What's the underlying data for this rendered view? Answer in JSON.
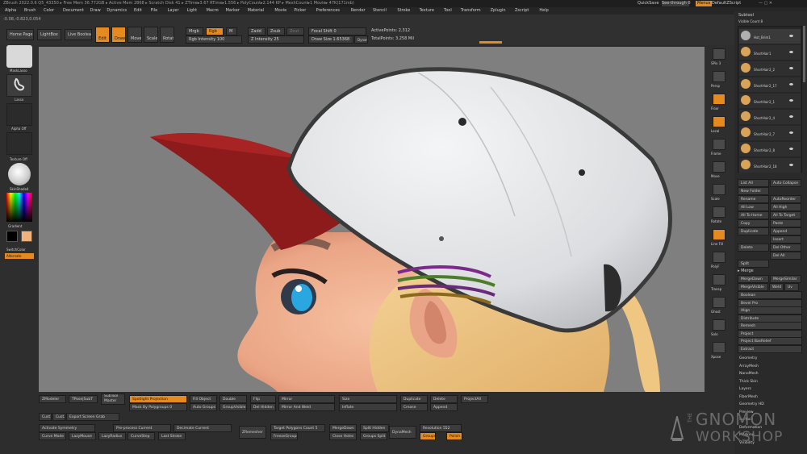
{
  "titlebar": {
    "text": "ZBrush 2022.0.6   Q5_43350   ▸ Free Mem 36.772GB ▸ Active Mem 2868 ▸ Scratch Disk 41 ▸ ZTime▸3.67 RTime▸1.556 ▸ PolyCount▸2.144 KP ▸ MeshCount▸1 Movie▸ 47K(171mb)",
    "quicksave": "QuickSave",
    "seethrough": "See-through 0",
    "menus": "Menus",
    "script": "DefaultZScript"
  },
  "menu": [
    "Alpha",
    "Brush",
    "Color",
    "Document",
    "Draw",
    "Dynamics",
    "Edit",
    "File",
    "Layer",
    "Light",
    "Macro",
    "Marker",
    "Material",
    "Movie",
    "Picker",
    "Preferences",
    "Render",
    "Stencil",
    "Stroke",
    "Texture",
    "Tool",
    "Transform",
    "Zplugin",
    "Zscript",
    "Help"
  ],
  "coords": "-0.08,-0.823,0.054",
  "toolbar": {
    "homepage": "Home Page",
    "lightbox": "LightBox",
    "live_boolean": "Live Boolean",
    "edit": "Edit",
    "draw": "Draw",
    "move": "Move",
    "scale": "Scale",
    "rotate": "Rotate",
    "mrgb": "Mrgb",
    "rgb": "Rgb",
    "m": "M",
    "rgb_intensity": "Rgb Intensity 100",
    "zadd": "Zadd",
    "zsub": "Zsub",
    "zcut": "Zcut",
    "z_intensity": "Z Intensity 25",
    "focal_shift": "Focal Shift 0",
    "draw_size": "Draw Size 1.65368",
    "dynamic": "Dynamic",
    "active_points": "ActivePoints: 2,312",
    "total_points": "TotalPoints: 3.258 Mil"
  },
  "leftshelf": {
    "brush": "MaskLasso",
    "stroke": "Lasso",
    "alpha": "Alpha Off",
    "texture": "Texture Off",
    "material": "SkinShade4",
    "gradient": "Gradient",
    "switchcolor": "SwitchColor",
    "alternate": "Alternate"
  },
  "rightshelf": [
    "SPix 3",
    "Persp",
    "Floor",
    "Local",
    "Frame",
    "Move",
    "Scale",
    "Rotate",
    "Line Fill",
    "PolyF",
    "Transp",
    "Ghost",
    "Solo",
    "Xpose"
  ],
  "subtool": {
    "title": "Subtool",
    "visible_count": "Visible Count 8",
    "items": [
      "Hat_Brim1",
      "ShortHair1",
      "ShortHair2_2",
      "ShortHair2_17",
      "ShortHair2_1",
      "ShortHair2_4",
      "ShortHair2_7",
      "ShortHair2_8",
      "ShortHair2_18"
    ],
    "buttons_a": [
      [
        "List All",
        "Auto Collapse"
      ],
      [
        "New Folder",
        ""
      ],
      [
        "Rename",
        "AutoReorder"
      ],
      [
        "All Low",
        "All High"
      ],
      [
        "All To Home",
        "All To Target"
      ],
      [
        "Copy",
        "Paste"
      ],
      [
        "Duplicate",
        "Append"
      ],
      [
        "",
        "Insert"
      ],
      [
        "Delete",
        "Del Other"
      ],
      [
        "",
        "Del All"
      ],
      [
        "Split",
        ""
      ]
    ],
    "merge_header": "▸ Merge",
    "merge_buttons": [
      [
        "MergeDown",
        "MergeSimilar"
      ],
      [
        "MergeVisible",
        "Weld",
        "Uv"
      ]
    ],
    "menu_list": [
      "Boolean",
      "Bevel Pro",
      "Align",
      "Distribute",
      "Remesh",
      "Project",
      "Project BasRelief",
      "Extract"
    ],
    "menu_list2": [
      "Geometry",
      "ArrayMesh",
      "NanoMesh",
      "Thick Skin",
      "Layers",
      "FiberMesh",
      "Geometry HD",
      "Preview",
      "Surface",
      "Deformation",
      "Masking",
      "Visibility"
    ]
  },
  "bottom": {
    "row1": [
      "ZModeler",
      "TPose|SubT",
      "SubTool Master",
      "Spotlight Projection",
      "Fill Object",
      "Double",
      "Flip",
      "Mirror",
      "Size",
      "Duplicate",
      "Delete",
      "ProjectAll"
    ],
    "row2": [
      "Mask By Polygroups 0",
      "Auto Groups",
      "GroupVisible",
      "Del Hidden",
      "Mirror And Weld",
      "Inflate",
      "Crease",
      "Append"
    ],
    "row3": [
      "Cust1",
      "Cust2",
      "Export Screen Grab"
    ],
    "row4": [
      "Activate Symmetry",
      "Pre-process Current",
      "Decimate Current",
      "Target Polygons Count 5",
      "MergeDown",
      "Split Hidden",
      "Resolution 552"
    ],
    "row5": [
      "Curve Mode",
      "LazyMouse",
      "LazyRadius",
      "CurveStep",
      "Last Stroke",
      "ZRemesher",
      "FreezeGroups",
      "Close Holes",
      "Groups Split",
      "DynaMesh",
      "Groups",
      "Polish"
    ]
  },
  "watermark": {
    "the": "THE",
    "line1": "GNOMON",
    "line2": "WORKSHOP"
  }
}
